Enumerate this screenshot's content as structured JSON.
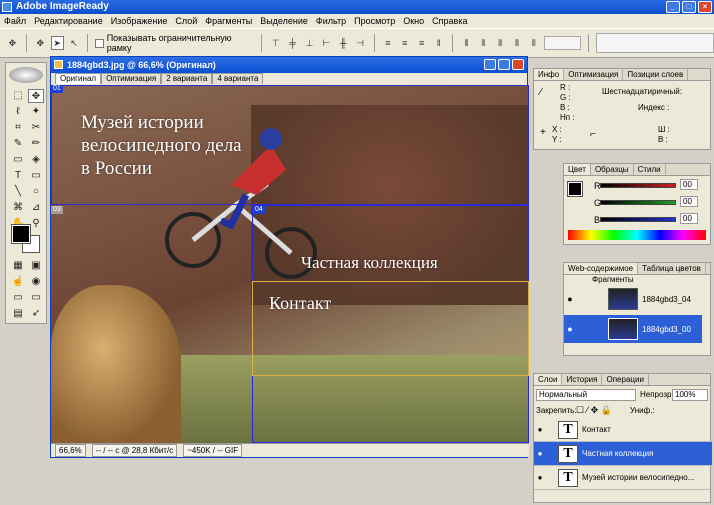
{
  "app": {
    "title": "Adobe ImageReady"
  },
  "menu": [
    "Файл",
    "Редактирование",
    "Изображение",
    "Слой",
    "Фрагменты",
    "Выделение",
    "Фильтр",
    "Просмотр",
    "Окно",
    "Справка"
  ],
  "options": {
    "show_bounds_label": "Показывать ограничительную рамку"
  },
  "document": {
    "title": "1884gbd3.jpg @ 66,6% (Оригинал)",
    "tabs": [
      "Оригинал",
      "Оптимизация",
      "2 варианта",
      "4 варианта"
    ],
    "slice_badges": {
      "s01": "01",
      "s04": "04",
      "s03": "03"
    },
    "canvas_text": {
      "museum_line1": "Музей истории",
      "museum_line2": "велосипедного дела",
      "museum_line3": "в России",
      "private": "Частная коллекция",
      "contact": "Контакт"
    },
    "status": {
      "zoom": "66,6%",
      "speed": "-- / -- с @ 28,8 Кбит/с",
      "size": "~450K / -- GIF"
    }
  },
  "info_panel": {
    "tabs": [
      "Инфо",
      "Оптимизация",
      "Позиции слоев"
    ],
    "r": "R :",
    "g": "G :",
    "b": "B :",
    "hn": "Нп :",
    "hex": "Шестнадцатиричный:",
    "index": "Индекс :",
    "x": "X :",
    "y": "Y :",
    "w": "Ш :",
    "h": "В :"
  },
  "color_panel": {
    "tabs": [
      "Цвет",
      "Образцы",
      "Стили"
    ],
    "r_label": "R",
    "g_label": "G",
    "b_label": "B",
    "r_val": "00",
    "g_val": "00",
    "b_val": "00",
    "colors": {
      "r_slider": "#cc2020",
      "g_slider": "#20a020",
      "b_slider": "#2030d0"
    }
  },
  "web_panel": {
    "tabs": [
      "Web-содержимое",
      "Таблица цветов"
    ],
    "group": "Фрагменты",
    "items": [
      {
        "label": "1884gbd3_04",
        "badge": "04"
      },
      {
        "label": "1884gbd3_00",
        "badge": "00"
      }
    ]
  },
  "layers_panel": {
    "tabs": [
      "Слои",
      "История",
      "Операции"
    ],
    "blend": "Нормальный",
    "opacity_label": "Непрозр.:",
    "opacity": "100%",
    "lock_label": "Закрепить:",
    "unify_label": "Униф.:",
    "layers": [
      {
        "name": "Контакт",
        "selected": false
      },
      {
        "name": "Частная коллекция",
        "selected": true
      },
      {
        "name": "Музей истории велосипедно...",
        "selected": false
      }
    ]
  }
}
